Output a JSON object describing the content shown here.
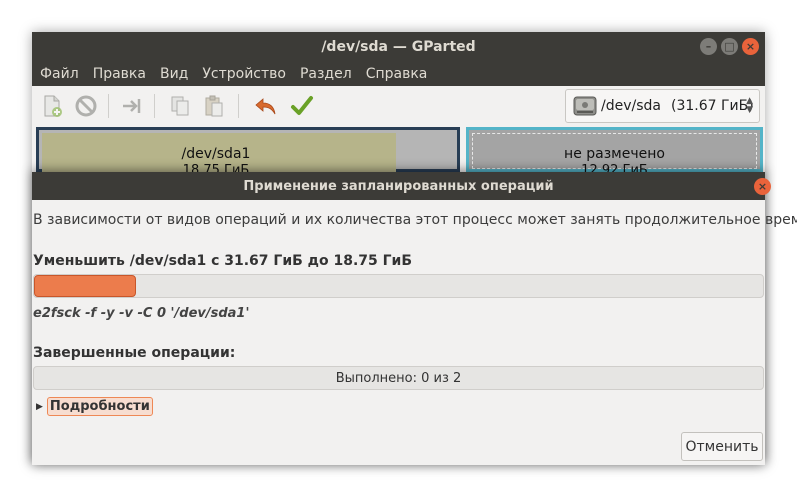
{
  "window": {
    "title": "/dev/sda — GParted",
    "close_glyph": "×",
    "minimize_glyph": "–",
    "maximize_glyph": "□"
  },
  "menubar": {
    "items": [
      "Файл",
      "Правка",
      "Вид",
      "Устройство",
      "Раздел",
      "Справка"
    ]
  },
  "toolbar": {
    "icons": [
      "new-partition-icon",
      "delete-icon",
      "resize-move-icon",
      "copy-icon",
      "paste-icon",
      "undo-icon",
      "apply-icon"
    ],
    "device_label": "/dev/sda",
    "device_size": "(31.67 ГиБ)",
    "accent_undo": "#d86a2e",
    "accent_apply": "#6aa127"
  },
  "partition_map": {
    "partitions": [
      {
        "label": "/dev/sda1",
        "size": "18.75 ГиБ",
        "color": "#b6b48a"
      },
      {
        "label": "не размечено",
        "size": "12.92 ГиБ",
        "color": "#a4a4a4"
      }
    ]
  },
  "dialog": {
    "title": "Применение запланированных операций",
    "description": "В зависимости от видов операций и их количества этот процесс может занять продолжительное время.",
    "current_operation": "Уменьшить /dev/sda1 с 31.67 ГиБ до 18.75 ГиБ",
    "current_progress_fraction": 0.14,
    "command": "e2fsck -f -y -v -C 0 '/dev/sda1'",
    "completed_title": "Завершенные операции:",
    "completed_text": "Выполнено: 0 из 2",
    "details_label": "Подробности",
    "cancel_label": "Отменить",
    "close_glyph": "×",
    "progress_color": "#ec7c4c"
  }
}
